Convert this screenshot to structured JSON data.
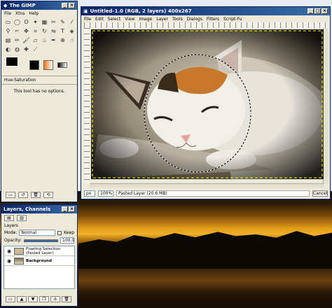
{
  "toolbox": {
    "title": "The GIMP",
    "menu": [
      "File",
      "Xtns",
      "Help"
    ],
    "tool_options_title": "Hue-Saturation",
    "tool_options_message": "This tool has no options."
  },
  "image_window": {
    "title": "Untitled-1.0 (RGB, 2 layers) 400x267",
    "menu": [
      "File",
      "Edit",
      "Select",
      "View",
      "Image",
      "Layer",
      "Tools",
      "Dialogs",
      "Filters",
      "Script-Fu"
    ],
    "unit": "px",
    "zoom": "100%",
    "status": "Pasted Layer (20.6 MB)",
    "cancel_label": "Cancel"
  },
  "layers_dialog": {
    "title": "Layers, Channels",
    "tab_label": "Layers",
    "mode_label": "Mode:",
    "mode_value": "Normal",
    "keep_label": "Keep",
    "opacity_label": "Opacity:",
    "opacity_value": "100.0",
    "layers": [
      {
        "name": "Floating Selection\n(Pasted Layer)"
      },
      {
        "name": "Background"
      }
    ]
  }
}
